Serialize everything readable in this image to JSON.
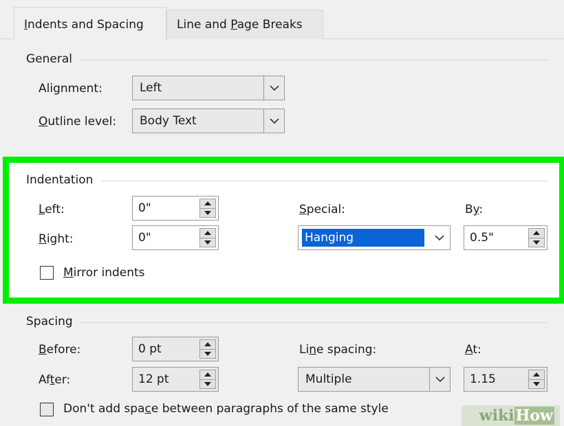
{
  "tabs": [
    {
      "label": "Indents and Spacing",
      "mnemonic": "I",
      "rest": "ndents and Spacing",
      "active": true
    },
    {
      "label": "Line and Page Breaks",
      "before": "Line and ",
      "mnemonic": "P",
      "rest": "age Breaks",
      "active": false
    }
  ],
  "general": {
    "title": "General",
    "alignment": {
      "label_mnemonic": "",
      "label": "Alignment:",
      "value": "Left"
    },
    "outline_level": {
      "label_mnemonic": "O",
      "label_rest": "utline level:",
      "value": "Body Text"
    }
  },
  "indentation": {
    "title": "Indentation",
    "left": {
      "label_mnemonic": "L",
      "label_rest": "eft:",
      "value": "0\""
    },
    "right": {
      "label_mnemonic": "R",
      "label_rest": "ight:",
      "value": "0\""
    },
    "special": {
      "label_mnemonic": "S",
      "label_rest": "pecial:",
      "value": "Hanging"
    },
    "by": {
      "label_before": "B",
      "label_mnemonic": "y",
      "label_rest": ":",
      "value": "0.5\""
    },
    "mirror": {
      "label_mnemonic": "M",
      "label_rest": "irror indents",
      "checked": false
    }
  },
  "spacing": {
    "title": "Spacing",
    "before": {
      "label_mnemonic": "B",
      "label_rest": "efore:",
      "value": "0 pt"
    },
    "after": {
      "label_before": "Af",
      "label_mnemonic": "t",
      "label_rest": "er:",
      "value": "12 pt"
    },
    "line_spacing": {
      "label_before": "Li",
      "label_mnemonic": "n",
      "label_rest": "e spacing:",
      "value": "Multiple"
    },
    "at": {
      "label_mnemonic": "A",
      "label_rest": "t:",
      "value": "1.15"
    },
    "dont_add": {
      "label_before": "Don't add spa",
      "label_mnemonic": "c",
      "label_rest": "e between paragraphs of the same style",
      "checked": false
    }
  },
  "watermark": {
    "part1": "wiki",
    "part2": "How"
  },
  "colors": {
    "highlight": "#00ee00",
    "selection": "#0a64d6",
    "dialog_bg": "#f0f0f0"
  }
}
